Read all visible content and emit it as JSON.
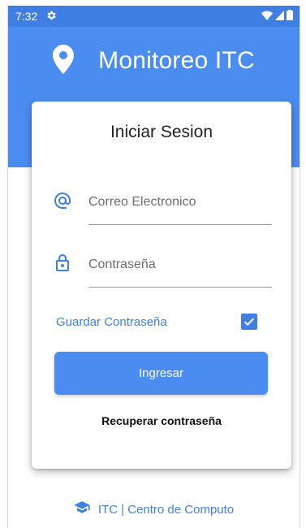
{
  "status_bar": {
    "time": "7:32",
    "settings_icon": "gear-icon",
    "icons": [
      "wifi-icon",
      "signal-icon",
      "battery-icon"
    ]
  },
  "app": {
    "title": "Monitoreo ITC",
    "logo_icon": "location-pin-icon"
  },
  "login": {
    "title": "Iniciar Sesion",
    "email": {
      "icon": "at-icon",
      "placeholder": "Correo Electronico",
      "value": ""
    },
    "password": {
      "icon": "lock-icon",
      "placeholder": "Contraseña",
      "value": ""
    },
    "remember": {
      "label": "Guardar Contraseña",
      "checked": true
    },
    "submit_label": "Ingresar",
    "recover_label": "Recuperar contraseña"
  },
  "footer": {
    "icon": "graduation-cap-icon",
    "label": "ITC | Centro de Computo"
  },
  "colors": {
    "primary": "#4b8cf0",
    "status_bar": "#3f7fe4",
    "accent_text": "#3f7fe4"
  }
}
